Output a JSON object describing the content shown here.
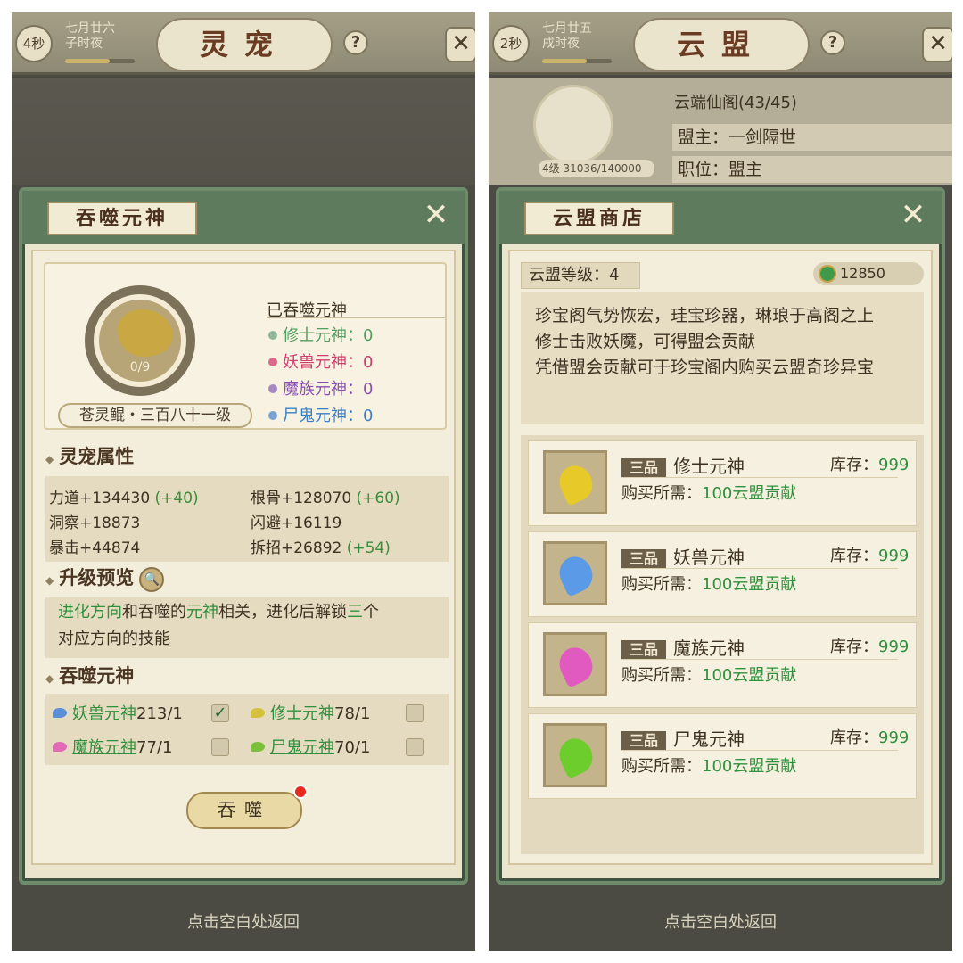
{
  "left": {
    "timer": "4秒",
    "date_line1": "七月廿六",
    "date_line2": "子时夜",
    "title": "灵宠",
    "help": "?",
    "close": "✕",
    "panel": {
      "title": "吞噬元神",
      "soul_count": "0/9",
      "pet_name": "苍灵鲲・三百八十一级",
      "eaten_title": "已吞噬元神",
      "eaten": [
        {
          "label": "修士元神：0",
          "color": "#4f9e62"
        },
        {
          "label": "妖兽元神：0",
          "color": "#d23b6e"
        },
        {
          "label": "魔族元神：0",
          "color": "#8a4fb0"
        },
        {
          "label": "尸鬼元神：0",
          "color": "#3d7fc4"
        }
      ],
      "attr_title": "灵宠属性",
      "attrs": [
        {
          "name": "力道+134430",
          "bonus": "(+40)"
        },
        {
          "name": "根骨+128070",
          "bonus": "(+60)"
        },
        {
          "name": "洞察+18873",
          "bonus": ""
        },
        {
          "name": "闪避+16119",
          "bonus": ""
        },
        {
          "name": "暴击+44874",
          "bonus": ""
        },
        {
          "name": "拆招+26892",
          "bonus": "(+54)"
        }
      ],
      "preview_title": "升级预览",
      "preview": {
        "p1": "进化方向",
        "p2": "和吞噬的",
        "p3": "元神",
        "p4": "相关，进化后解锁",
        "p5": "三",
        "p6": "个",
        "p7": "对应方向的技能"
      },
      "devour_title": "吞噬元神",
      "devour_items": [
        {
          "name": "妖兽元神",
          "count": "213/1",
          "color": "#5b8fd8",
          "checked": "✓"
        },
        {
          "name": "修士元神",
          "count": "78/1",
          "color": "#d6c13c",
          "checked": ""
        },
        {
          "name": "魔族元神",
          "count": "77/1",
          "color": "#e26bb7",
          "checked": ""
        },
        {
          "name": "尸鬼元神",
          "count": "70/1",
          "color": "#7cc13c",
          "checked": ""
        }
      ],
      "devour_button": "吞噬"
    },
    "footer": "点击空白处返回"
  },
  "right": {
    "timer": "2秒",
    "date_line1": "七月廿五",
    "date_line2": "戌时夜",
    "title": "云盟",
    "help": "?",
    "union_name": "云端仙阁(43/45)",
    "leader": "盟主：一剑隔世",
    "position": "职位：盟主",
    "union_level": "4级",
    "union_exp": "31036/140000",
    "panel": {
      "title": "云盟商店",
      "level": "云盟等级：4",
      "coins": "12850",
      "desc": [
        "珍宝阁气势恢宏，珪宝珍器，琳琅于高阁之上",
        "修士击败妖魔，可得盟会贡献",
        "凭借盟会贡献可于珍宝阁内购买云盟奇珍异宝"
      ],
      "items": [
        {
          "grade": "三品",
          "name": "修士元神",
          "stock_label": "库存：",
          "stock": "999",
          "cost_label": "购买所需：",
          "cost": "100云盟贡献",
          "color": "#e8c92a"
        },
        {
          "grade": "三品",
          "name": "妖兽元神",
          "stock_label": "库存：",
          "stock": "999",
          "cost_label": "购买所需：",
          "cost": "100云盟贡献",
          "color": "#5a9ae6"
        },
        {
          "grade": "三品",
          "name": "魔族元神",
          "stock_label": "库存：",
          "stock": "999",
          "cost_label": "购买所需：",
          "cost": "100云盟贡献",
          "color": "#e05ac0"
        },
        {
          "grade": "三品",
          "name": "尸鬼元神",
          "stock_label": "库存：",
          "stock": "999",
          "cost_label": "购买所需：",
          "cost": "100云盟贡献",
          "color": "#6ccd2c"
        }
      ]
    },
    "footer": "点击空白处返回"
  }
}
